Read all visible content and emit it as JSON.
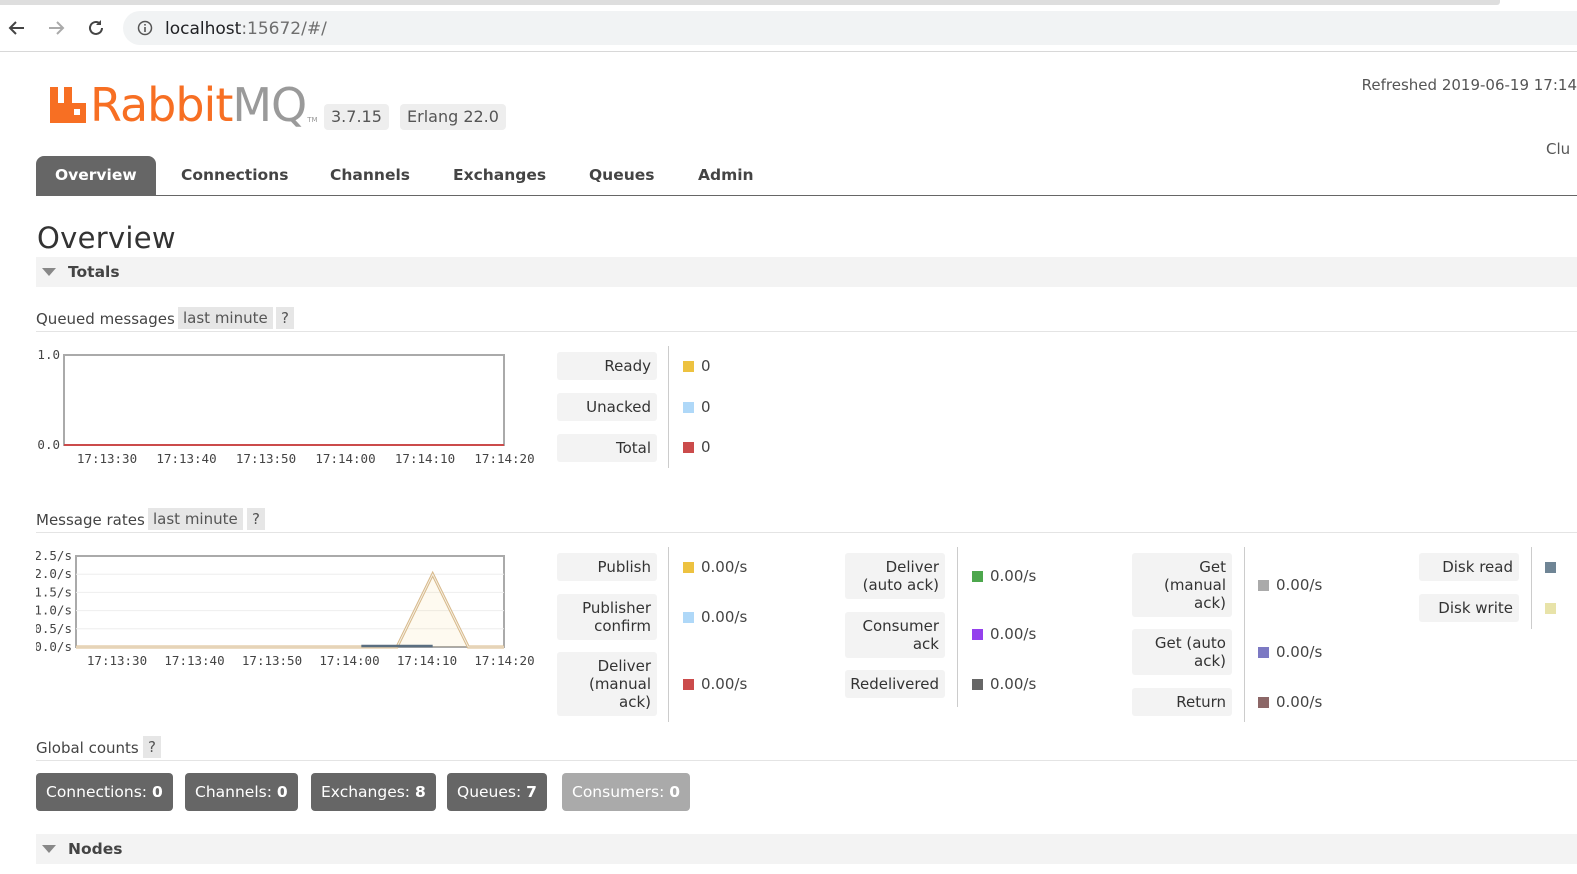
{
  "browser": {
    "url_host": "localhost",
    "url_rest": ":15672/#/"
  },
  "header": {
    "logo_rabbit": "Rabbit",
    "logo_mq": "MQ",
    "logo_tm": "TM",
    "version": "3.7.15",
    "erlang": "Erlang 22.0",
    "refreshed": "Refreshed 2019-06-19 17:14",
    "cluster": "Clu"
  },
  "tabs": [
    {
      "label": "Overview"
    },
    {
      "label": "Connections"
    },
    {
      "label": "Channels"
    },
    {
      "label": "Exchanges"
    },
    {
      "label": "Queues"
    },
    {
      "label": "Admin"
    }
  ],
  "page_title": "Overview",
  "totals_section": "Totals",
  "queued": {
    "heading": "Queued messages",
    "range": "last minute",
    "help": "?",
    "stats": [
      {
        "label": "Ready",
        "value": "0",
        "color": "#edc240"
      },
      {
        "label": "Unacked",
        "value": "0",
        "color": "#afd8f8"
      },
      {
        "label": "Total",
        "value": "0",
        "color": "#cb4b4b"
      }
    ]
  },
  "rates": {
    "heading": "Message rates",
    "range": "last minute",
    "help": "?",
    "col1": [
      {
        "label": "Publish",
        "value": "0.00/s",
        "color": "#edc240"
      },
      {
        "label": "Publisher confirm",
        "value": "0.00/s",
        "color": "#afd8f8"
      },
      {
        "label": "Deliver (manual ack)",
        "value": "0.00/s",
        "color": "#cb4b4b"
      }
    ],
    "col2": [
      {
        "label": "Deliver (auto ack)",
        "value": "0.00/s",
        "color": "#4da74d"
      },
      {
        "label": "Consumer ack",
        "value": "0.00/s",
        "color": "#9440ed"
      },
      {
        "label": "Redelivered",
        "value": "0.00/s",
        "color": "#666666"
      }
    ],
    "col3": [
      {
        "label": "Get (manual ack)",
        "value": "0.00/s",
        "color": "#aaaaaa"
      },
      {
        "label": "Get (auto ack)",
        "value": "0.00/s",
        "color": "#7c79c3"
      },
      {
        "label": "Return",
        "value": "0.00/s",
        "color": "#8c6767"
      }
    ],
    "col4": [
      {
        "label": "Disk read",
        "value": "",
        "color": "#6f8595"
      },
      {
        "label": "Disk write",
        "value": "",
        "color": "#e8e3a9"
      }
    ]
  },
  "global_counts": {
    "heading": "Global counts",
    "help": "?",
    "items": [
      {
        "label": "Connections:",
        "value": "0"
      },
      {
        "label": "Channels:",
        "value": "0"
      },
      {
        "label": "Exchanges:",
        "value": "8"
      },
      {
        "label": "Queues:",
        "value": "7"
      },
      {
        "label": "Consumers:",
        "value": "0"
      }
    ]
  },
  "nodes_section": "Nodes",
  "chart_data": [
    {
      "type": "line",
      "x": [
        "17:13:30",
        "17:13:40",
        "17:13:50",
        "17:14:00",
        "17:14:10",
        "17:14:20"
      ],
      "ylim": [
        0,
        1.0
      ],
      "yticks": [
        "1.0",
        "0.0"
      ],
      "series": [
        {
          "name": "Ready",
          "values": [
            0,
            0,
            0,
            0,
            0,
            0
          ]
        },
        {
          "name": "Unacked",
          "values": [
            0,
            0,
            0,
            0,
            0,
            0
          ]
        },
        {
          "name": "Total",
          "values": [
            0,
            0,
            0,
            0,
            0,
            0
          ]
        }
      ]
    },
    {
      "type": "area",
      "x": [
        "17:13:30",
        "17:13:40",
        "17:13:50",
        "17:14:00",
        "17:14:10",
        "17:14:20"
      ],
      "ylim": [
        0,
        2.5
      ],
      "yticks": [
        "2.5/s",
        "2.0/s",
        "1.5/s",
        "1.0/s",
        "0.5/s",
        "0.0/s"
      ],
      "series": [
        {
          "name": "Publish",
          "points_t": [
            0,
            40,
            45,
            50,
            55,
            60
          ],
          "values": [
            0,
            0,
            0,
            2.0,
            0,
            0
          ]
        }
      ]
    }
  ]
}
